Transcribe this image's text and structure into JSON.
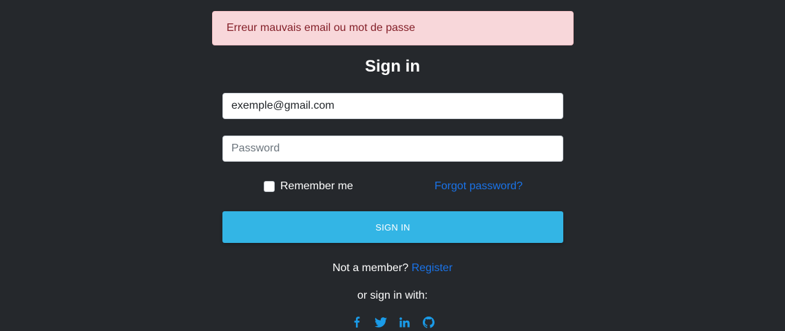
{
  "alert": {
    "message": "Erreur mauvais email ou mot de passe"
  },
  "form": {
    "title": "Sign in",
    "email_value": "exemple@gmail.com",
    "password_placeholder": "Password",
    "remember_label": "Remember me",
    "forgot_label": "Forgot password?",
    "submit_label": "SIGN IN",
    "not_member_text": "Not a member?",
    "register_label": "Register",
    "or_text": "or sign in with:"
  },
  "socials": [
    {
      "icon": "facebook-icon"
    },
    {
      "icon": "twitter-icon"
    },
    {
      "icon": "linkedin-icon"
    },
    {
      "icon": "github-icon"
    }
  ],
  "colors": {
    "background": "#25282c",
    "alert_bg": "#f8d7da",
    "alert_text": "#842029",
    "button": "#33b5e5",
    "link": "#1a73e8"
  }
}
